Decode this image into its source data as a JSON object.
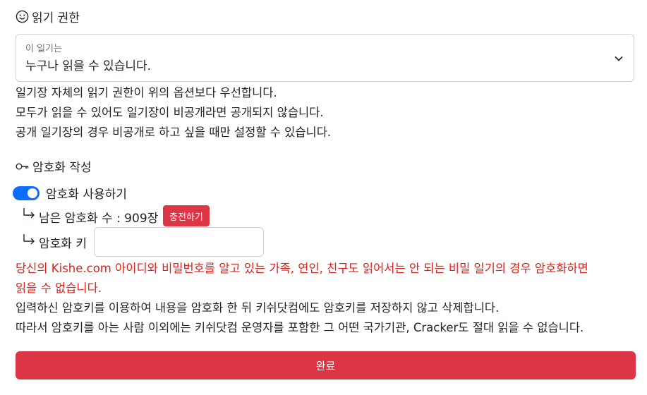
{
  "read_permission": {
    "title": "읽기 권한",
    "icon": "smile-icon",
    "select_label": "이 일기는",
    "select_value": "누구나 읽을 수 있습니다.",
    "notes": [
      "일기장 자체의 읽기 권한이 위의 옵션보다 우선합니다.",
      "모두가 읽을 수 있어도 일기장이 비공개라면 공개되지 않습니다.",
      "공개 일기장의 경우 비공개로 하고 싶을 때만 설정할 수 있습니다."
    ]
  },
  "encryption": {
    "title": "암호화 작성",
    "icon": "key-icon",
    "toggle_label": "암호화 사용하기",
    "toggle_on": true,
    "remaining_label": "남은 암호화 수 : 909장",
    "charge_button": "충전하기",
    "key_label": "암호화 키",
    "key_value": "",
    "warning_line1": "당신의 Kishe.com 아이디와 비밀번호를 알고 있는 가족, 연인, 친구도 읽어서는 안 되는 비밀 일기의 경우 암호화하면",
    "warning_line2": "읽을 수 없습니다.",
    "info_line1": "입력하신 암호키를 이용하여 내용을 암호화 한 뒤 키쉬닷컴에도 암호키를 저장하지 않고 삭제합니다.",
    "info_line2": "따라서 암호키를 아는 사람 이외에는 키쉬닷컴 운영자를 포함한 그 어떤 국가기관, Cracker도 절대 읽을 수 없습니다."
  },
  "submit_label": "완료",
  "colors": {
    "primary": "#0d6efd",
    "danger": "#dc3545",
    "warning_text": "#e0201b",
    "border": "#ced4da"
  }
}
